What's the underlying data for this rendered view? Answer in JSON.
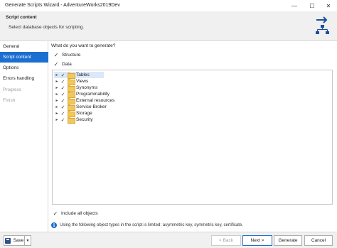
{
  "window": {
    "title": "Generate Scripts Wizard - AdventureWorks2019Dev",
    "minimize_glyph": "—",
    "maximize_glyph": "☐",
    "close_glyph": "✕"
  },
  "header": {
    "title": "Script content",
    "subtitle": "Select database objects for scripting.",
    "icon": "schema-flow-icon"
  },
  "sidebar": {
    "items": [
      {
        "label": "General",
        "state": "normal"
      },
      {
        "label": "Script content",
        "state": "active"
      },
      {
        "label": "Options",
        "state": "normal"
      },
      {
        "label": "Errors handling",
        "state": "normal"
      },
      {
        "label": "Progress",
        "state": "disabled"
      },
      {
        "label": "Finish",
        "state": "disabled"
      }
    ]
  },
  "main": {
    "question": "What do you want to generate?",
    "structure_label": "Structure",
    "structure_checked": true,
    "data_label": "Data",
    "data_checked": true,
    "tree": [
      {
        "label": "Tables",
        "checked": true
      },
      {
        "label": "Views",
        "checked": true
      },
      {
        "label": "Synonyms",
        "checked": true
      },
      {
        "label": "Programmability",
        "checked": true
      },
      {
        "label": "External resources",
        "checked": true
      },
      {
        "label": "Service Broker",
        "checked": true
      },
      {
        "label": "Storage",
        "checked": true
      },
      {
        "label": "Security",
        "checked": true
      }
    ],
    "include_all_label": "Include all objects",
    "include_all_checked": true,
    "info_text": "Using the following object types in the script is limited: asymmetric key, symmetric key, certificate."
  },
  "footer": {
    "save_label": "Save",
    "back_label": "< Back",
    "next_label": "Next >",
    "generate_label": "Generate",
    "cancel_label": "Cancel"
  },
  "colors": {
    "accent": "#1c6fd1",
    "folder": "#f2c85b"
  }
}
